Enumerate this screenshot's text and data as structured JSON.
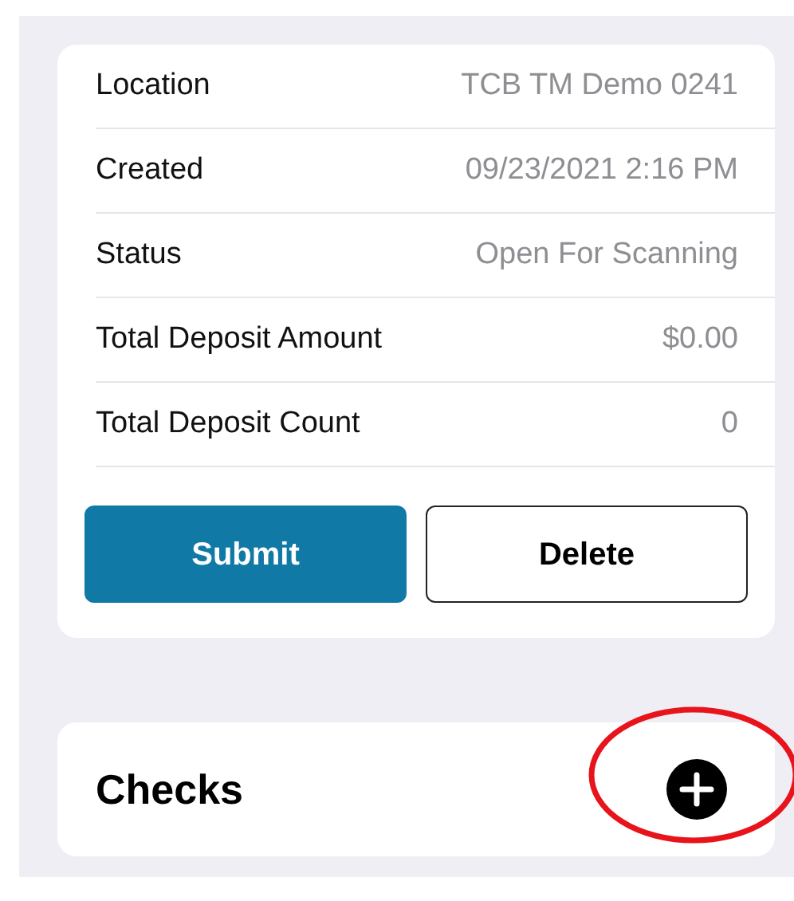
{
  "details": [
    {
      "label": "Location",
      "value": "TCB TM Demo 0241"
    },
    {
      "label": "Created",
      "value": "09/23/2021 2:16 PM"
    },
    {
      "label": "Status",
      "value": "Open For Scanning"
    },
    {
      "label": "Total Deposit Amount",
      "value": "$0.00"
    },
    {
      "label": "Total Deposit Count",
      "value": "0"
    }
  ],
  "buttons": [
    {
      "label": "Submit",
      "kind": "primary"
    },
    {
      "label": "Delete",
      "kind": "secondary"
    }
  ],
  "checks": {
    "title": "Checks",
    "highlighted": true
  }
}
